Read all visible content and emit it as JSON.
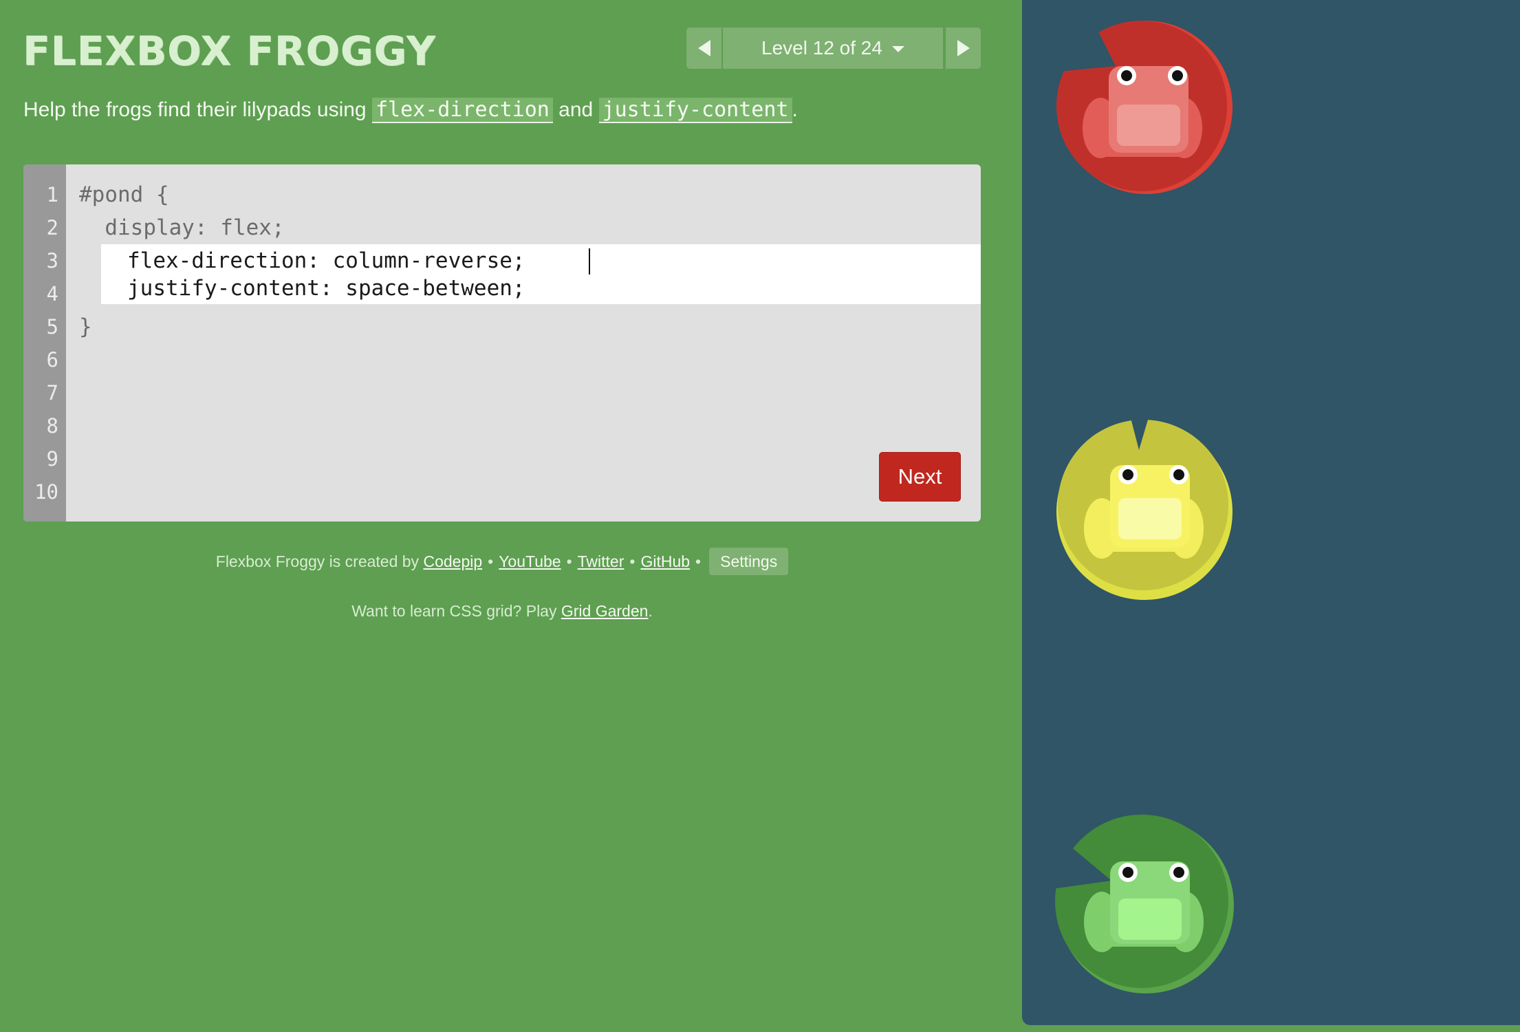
{
  "app": {
    "title": "FLEXBOX FROGGY",
    "level_label": "Level 12 of 24"
  },
  "instructions": {
    "prefix": "Help the frogs find their lilypads using ",
    "kw1": "flex-direction",
    "mid": " and ",
    "kw2": "justify-content",
    "suffix": "."
  },
  "editor": {
    "line_numbers": [
      "1",
      "2",
      "3",
      "4",
      "5",
      "6",
      "7",
      "8",
      "9",
      "10"
    ],
    "line1": "#pond {",
    "line2": "  display: flex;",
    "input_value": "flex-direction: column-reverse;\njustify-content: space-between;",
    "closing": "}",
    "next_label": "Next"
  },
  "footer": {
    "credit_prefix": "Flexbox Froggy is created by ",
    "links": [
      "Codepip",
      "YouTube",
      "Twitter",
      "GitHub"
    ],
    "settings_label": "Settings",
    "promo_prefix": "Want to learn CSS grid? Play ",
    "promo_link": "Grid Garden",
    "promo_suffix": "."
  },
  "pond": {
    "frogs": [
      {
        "color": "red",
        "pad": "#c0302a",
        "body": "#e25d57"
      },
      {
        "color": "yellow",
        "pad": "#c5c43f",
        "body": "#f6f263"
      },
      {
        "color": "green",
        "pad": "#448b3a",
        "body": "#7ecf6c"
      }
    ]
  },
  "colors": {
    "background": "#5e9f51",
    "pond": "#2f5566",
    "accent": "#c0281f"
  }
}
